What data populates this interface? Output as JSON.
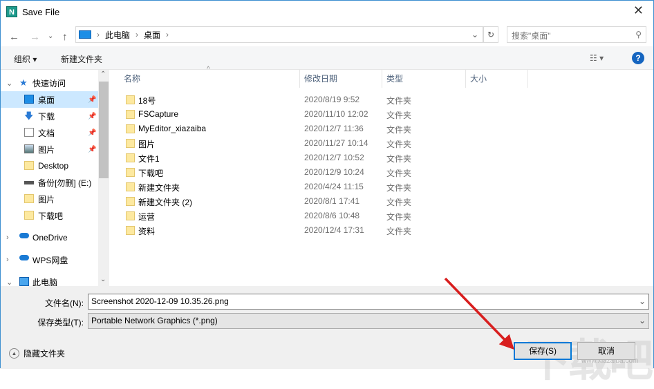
{
  "window": {
    "title": "Save File",
    "logo": "N"
  },
  "nav": {
    "path": [
      "此电脑",
      "桌面"
    ],
    "search_placeholder": "搜索\"桌面\""
  },
  "toolbar": {
    "organize": "组织 ▾",
    "new_folder": "新建文件夹",
    "help": "?"
  },
  "sidebar": [
    {
      "label": "快速访问",
      "icon": "star-icon",
      "level": 0,
      "expand": "⌄"
    },
    {
      "label": "桌面",
      "icon": "desktop-icon",
      "pinned": true,
      "selected": true
    },
    {
      "label": "下载",
      "icon": "download-icon",
      "pinned": true
    },
    {
      "label": "文档",
      "icon": "document-icon",
      "pinned": true
    },
    {
      "label": "图片",
      "icon": "pictures-icon",
      "pinned": true
    },
    {
      "label": "Desktop",
      "icon": "folder-icon"
    },
    {
      "label": "备份[勿删] (E:)",
      "icon": "drive-icon"
    },
    {
      "label": "图片",
      "icon": "folder-icon"
    },
    {
      "label": "下载吧",
      "icon": "folder-icon"
    },
    {
      "label": "OneDrive",
      "icon": "cloud-icon",
      "level": 0,
      "expand": "›"
    },
    {
      "label": "WPS网盘",
      "icon": "cloud-icon",
      "level": 0,
      "expand": "›"
    },
    {
      "label": "此电脑",
      "icon": "computer-icon",
      "level": 0,
      "expand": "⌄"
    }
  ],
  "columns": [
    "名称",
    "修改日期",
    "类型",
    "大小"
  ],
  "files": [
    {
      "name": "18号",
      "date": "2020/8/19 9:52",
      "type": "文件夹"
    },
    {
      "name": "FSCapture",
      "date": "2020/11/10 12:02",
      "type": "文件夹"
    },
    {
      "name": "MyEditor_xiazaiba",
      "date": "2020/12/7 11:36",
      "type": "文件夹"
    },
    {
      "name": "图片",
      "date": "2020/11/27 10:14",
      "type": "文件夹"
    },
    {
      "name": "文件1",
      "date": "2020/12/7 10:52",
      "type": "文件夹"
    },
    {
      "name": "下载吧",
      "date": "2020/12/9 10:24",
      "type": "文件夹"
    },
    {
      "name": "新建文件夹",
      "date": "2020/4/24 11:15",
      "type": "文件夹"
    },
    {
      "name": "新建文件夹 (2)",
      "date": "2020/8/1 17:41",
      "type": "文件夹"
    },
    {
      "name": "运营",
      "date": "2020/8/6 10:48",
      "type": "文件夹"
    },
    {
      "name": "资料",
      "date": "2020/12/4 17:31",
      "type": "文件夹"
    }
  ],
  "form": {
    "filename_label": "文件名(N):",
    "filename": "Screenshot 2020-12-09 10.35.26.png",
    "type_label": "保存类型(T):",
    "type": "Portable Network Graphics (*.png)"
  },
  "footer": {
    "hide_folders": "隐藏文件夹",
    "save": "保存(S)",
    "cancel": "取消"
  },
  "watermark": {
    "text": "下载吧",
    "url": "www.xiazaiba.com"
  }
}
